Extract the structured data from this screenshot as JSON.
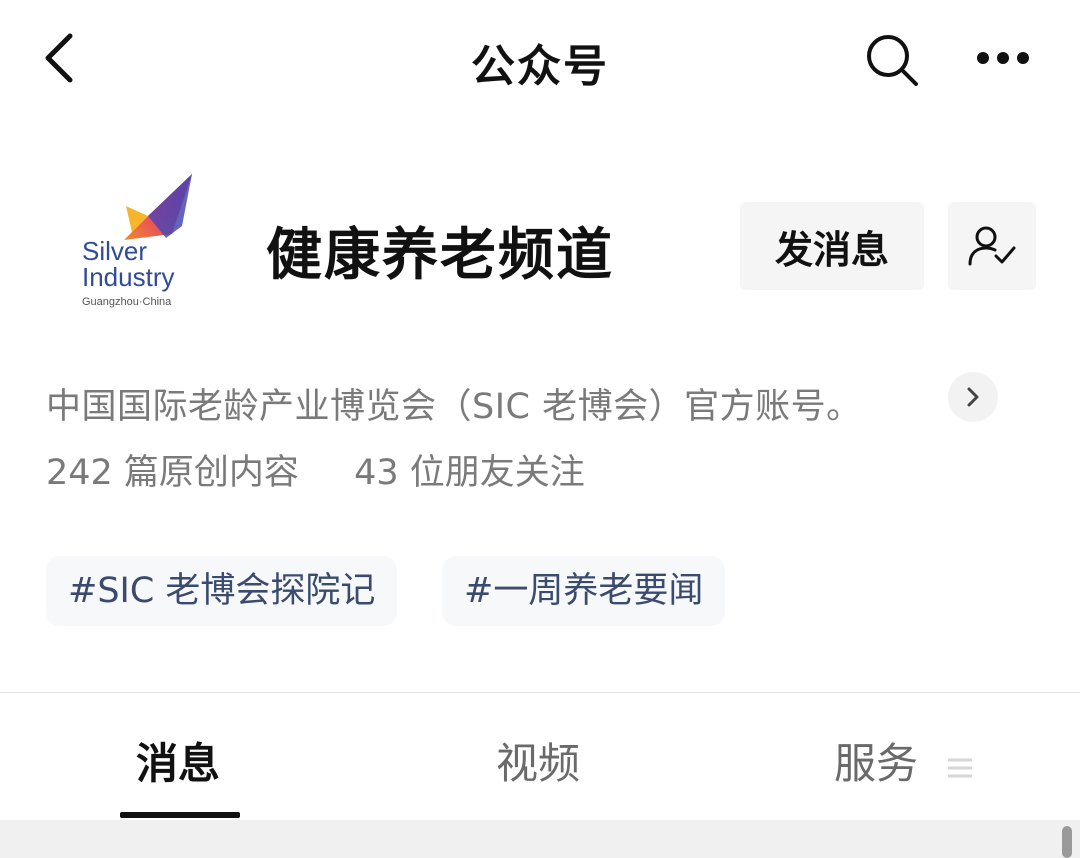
{
  "navbar": {
    "title": "公众号",
    "back_icon": "chevron-left-icon",
    "search_icon": "search-icon",
    "more_icon": "more-dots-icon"
  },
  "profile": {
    "logo": {
      "line1": "Silver",
      "line2": "Industry",
      "line3": "Guangzhou·China"
    },
    "name": "健康养老频道",
    "message_button": "发消息",
    "follow_icon": "followed-user-check-icon",
    "description": "中国国际老龄产业博览会（SIC 老博会）官方账号。",
    "stats": {
      "articles": "242 篇原创内容",
      "friends": "43 位朋友关注"
    }
  },
  "tags": [
    {
      "label": "#SIC 老博会探院记"
    },
    {
      "label": "#一周养老要闻"
    }
  ],
  "tabs": [
    {
      "label": "消息",
      "active": true
    },
    {
      "label": "视频",
      "active": false
    },
    {
      "label": "服务",
      "active": false
    }
  ],
  "colors": {
    "text_primary": "#111111",
    "text_secondary": "#7a7a7a",
    "tag_text": "#3a4b6e",
    "button_bg": "#f5f5f5"
  }
}
